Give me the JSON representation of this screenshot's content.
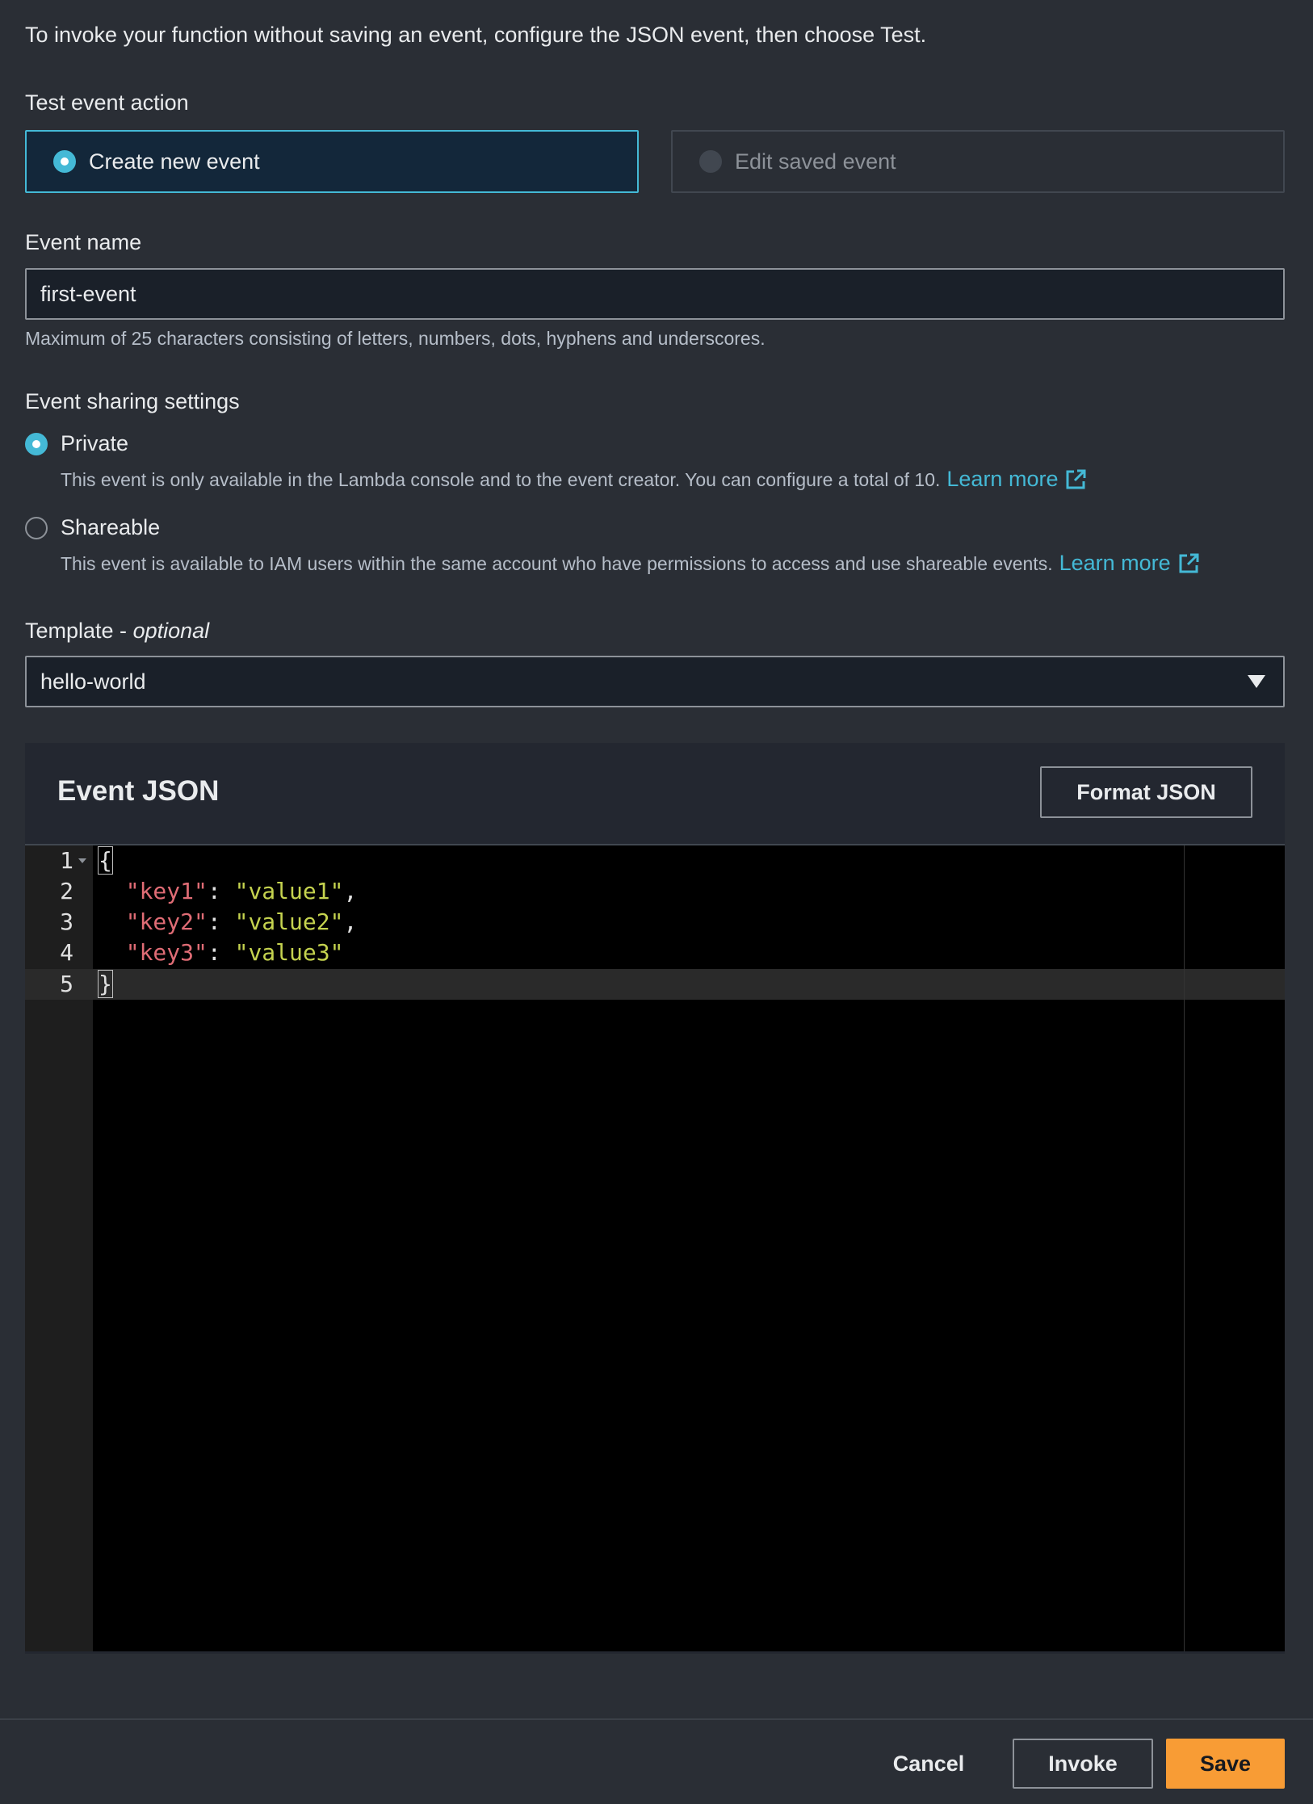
{
  "intro": "To invoke your function without saving an event, configure the JSON event, then choose Test.",
  "test_event_action": {
    "label": "Test event action",
    "options": [
      {
        "label": "Create new event",
        "selected": true,
        "disabled": false
      },
      {
        "label": "Edit saved event",
        "selected": false,
        "disabled": true
      }
    ]
  },
  "event_name": {
    "label": "Event name",
    "value": "first-event",
    "hint": "Maximum of 25 characters consisting of letters, numbers, dots, hyphens and underscores."
  },
  "sharing": {
    "label": "Event sharing settings",
    "private": {
      "label": "Private",
      "selected": true,
      "description": "This event is only available in the Lambda console and to the event creator. You can configure a total of 10.",
      "learn_more": "Learn more"
    },
    "shareable": {
      "label": "Shareable",
      "selected": false,
      "description": "This event is available to IAM users within the same account who have permissions to access and use shareable events.",
      "learn_more": "Learn more"
    }
  },
  "template": {
    "label": "Template - ",
    "label_optional": "optional",
    "value": "hello-world"
  },
  "event_json": {
    "title": "Event JSON",
    "format_button": "Format JSON",
    "lines": [
      {
        "num": "1",
        "open": "{"
      },
      {
        "num": "2",
        "key": "\"key1\"",
        "sep": ": ",
        "val": "\"value1\"",
        "end": ","
      },
      {
        "num": "3",
        "key": "\"key2\"",
        "sep": ": ",
        "val": "\"value2\"",
        "end": ","
      },
      {
        "num": "4",
        "key": "\"key3\"",
        "sep": ": ",
        "val": "\"value3\"",
        "end": ""
      },
      {
        "num": "5",
        "close": "}"
      }
    ]
  },
  "footer": {
    "cancel": "Cancel",
    "invoke": "Invoke",
    "save": "Save"
  },
  "colors": {
    "accent": "#44b9d6",
    "primary_button": "#f89c35",
    "background": "#2a2e35",
    "json_key": "#e06c75",
    "json_string": "#c5d34f"
  },
  "icons": {
    "external_link": "external-link-icon",
    "dropdown": "caret-down-icon"
  }
}
